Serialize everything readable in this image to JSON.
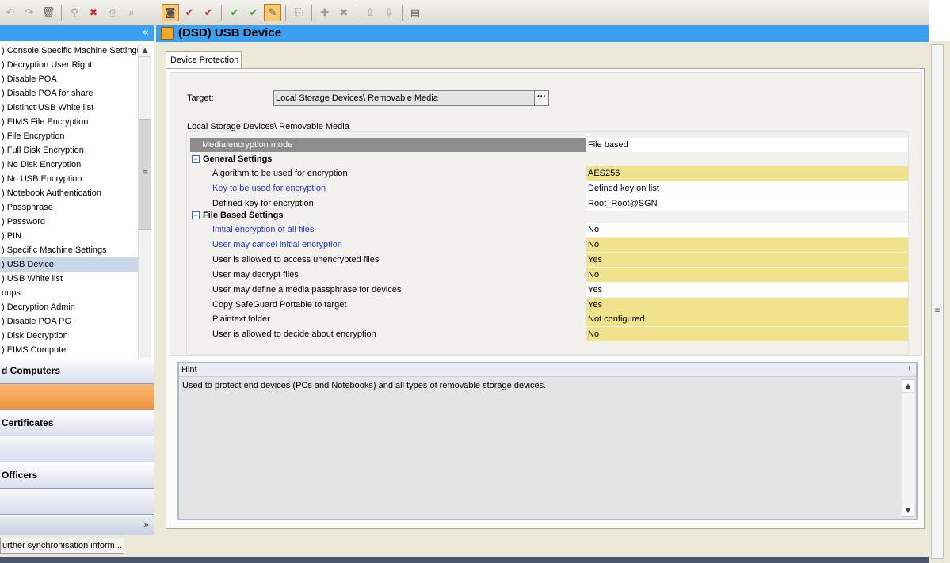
{
  "toolbar": {
    "left_icons": [
      "undo-icon",
      "redo-icon",
      "delete-icon",
      "find-icon",
      "remove-icon",
      "print-icon",
      "preview-icon"
    ],
    "right_icons": [
      "policy-view-icon",
      "check-icon",
      "check-all-icon",
      "approve-icon",
      "approve-all-icon",
      "edit-icon",
      "import-icon",
      "add-icon",
      "remove-icon",
      "up-icon",
      "down-icon",
      "report-icon"
    ]
  },
  "left_panel": {
    "collapse_glyph": "«",
    "tree_items": [
      ") Console Specific Machine Settings",
      ") Decryption User Right",
      ") Disable POA",
      ") Disable POA for share",
      ") Distinct USB White list",
      ") EIMS File Encryption",
      ") File Encryption",
      ") Full Disk Encryption",
      ") No Disk Encryption",
      ") No USB Encryption",
      ") Notebook Authentication",
      ") Passphrase",
      ") Password",
      ") PIN",
      ") Specific Machine Settings",
      ") USB Device",
      ") USB White list",
      "oups",
      ") Decryption Admin",
      ") Disable POA PG",
      ") Disk Decryption",
      ") EIMS Computer"
    ],
    "selected_index": 15,
    "nav_buttons": [
      {
        "label": "d Computers",
        "style": "normal"
      },
      {
        "label": "",
        "style": "orange"
      },
      {
        "label": " Certificates",
        "style": "normal"
      },
      {
        "label": "",
        "style": "plain"
      },
      {
        "label": "Officers",
        "style": "normal"
      },
      {
        "label": "",
        "style": "plain"
      }
    ],
    "more_glyph": "»"
  },
  "status": {
    "button_label": "urther synchronisation inform..."
  },
  "main": {
    "title": "(DSD) USB Device",
    "tab_label": "Device Protection",
    "target_label": "Target:",
    "target_value": "Local Storage Devices\\ Removable Media",
    "target_button": "···",
    "section_caption": "Local Storage Devices\\ Removable Media",
    "mode": {
      "name": "Media encryption mode",
      "value": "File based"
    },
    "general_header": "General Settings",
    "general": [
      {
        "name": "Algorithm to be used for encryption",
        "value": "AES256",
        "yellow": true,
        "blue": false
      },
      {
        "name": "Key to be used for encryption",
        "value": "Defined key on list",
        "yellow": false,
        "blue": true
      },
      {
        "name": "Defined key for encryption",
        "value": "Root_Root@SGN",
        "yellow": false,
        "blue": false
      }
    ],
    "filebased_header": "File Based Settings",
    "filebased": [
      {
        "name": "Initial encryption of all files",
        "value": "No",
        "yellow": false,
        "blue": true
      },
      {
        "name": "User may cancel initial encryption",
        "value": "No",
        "yellow": true,
        "blue": true
      },
      {
        "name": "User is allowed to access unencrypted files",
        "value": "Yes",
        "yellow": true,
        "blue": false
      },
      {
        "name": "User may decrypt files",
        "value": "No",
        "yellow": true,
        "blue": false
      },
      {
        "name": "User may define a media passphrase for devices",
        "value": "Yes",
        "yellow": false,
        "blue": false
      },
      {
        "name": "Copy SafeGuard Portable to target",
        "value": "Yes",
        "yellow": true,
        "blue": false
      },
      {
        "name": "Plaintext folder",
        "value": "Not configured",
        "yellow": true,
        "blue": false
      },
      {
        "name": "User is allowed to decide about encryption",
        "value": "No",
        "yellow": true,
        "blue": false
      }
    ],
    "hint_title": "Hint",
    "hint_text": "Used to protect end devices (PCs and Notebooks) and all types of removable storage devices."
  },
  "colors": {
    "header_blue": "#3aa0ef",
    "highlight_yellow": "#f1e28e",
    "link_blue": "#2538c8",
    "selected_orange": "#f1933f"
  }
}
